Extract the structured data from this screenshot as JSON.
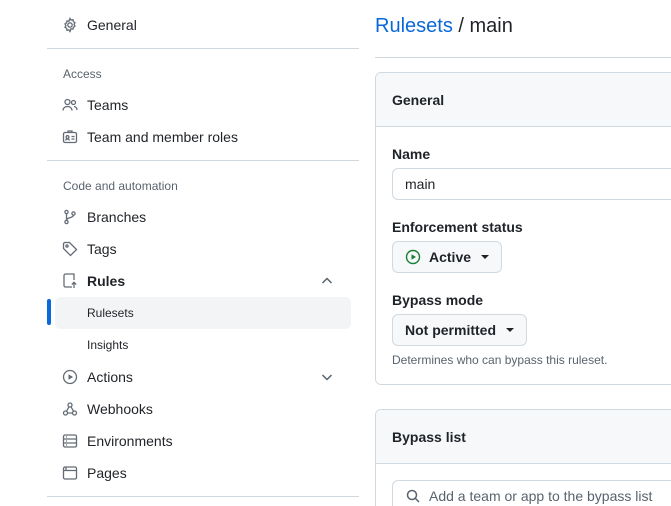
{
  "sidebar": {
    "general": "General",
    "access_title": "Access",
    "teams": "Teams",
    "team_roles": "Team and member roles",
    "code_title": "Code and automation",
    "branches": "Branches",
    "tags": "Tags",
    "rules": "Rules",
    "rulesets": "Rulesets",
    "insights": "Insights",
    "actions": "Actions",
    "webhooks": "Webhooks",
    "environments": "Environments",
    "pages": "Pages"
  },
  "breadcrumb": {
    "link": "Rulesets",
    "separator": "/",
    "current": "main"
  },
  "general_box": {
    "title": "General",
    "name_label": "Name",
    "name_value": "main",
    "enforcement_label": "Enforcement status",
    "enforcement_value": "Active",
    "bypass_label": "Bypass mode",
    "bypass_value": "Not permitted",
    "bypass_hint": "Determines who can bypass this ruleset."
  },
  "bypass_box": {
    "title": "Bypass list",
    "search_placeholder": "Add a team or app to the bypass list"
  },
  "colors": {
    "accent": "#0969da",
    "active_green": "#1a7f37",
    "border": "#d1d9e0"
  }
}
